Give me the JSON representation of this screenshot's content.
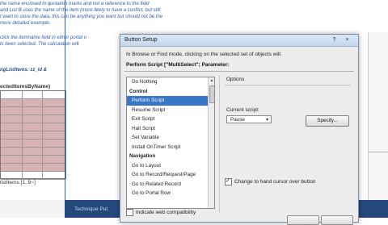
{
  "background": {
    "lines": [
      "the name enclosed in quotation marks and not a reference to the field",
      "and List B uses the name of the item (more likely to have a conflict, but still",
      "t want to store the data, this can be anything you want but should not be the",
      "more detailed example.",
      "",
      "click the itemname field in either portal o",
      "ts been selected. The calculation will",
      "",
      "ngListItems: zz_id &"
    ],
    "table_header": "ectedItemsByName)",
    "table_footer": "listItems [1..9~]",
    "status_text": "Technique Put"
  },
  "dialog": {
    "title": "Button Setup",
    "help_glyph": "?",
    "close_glyph": "×",
    "hint": "In Browse or Find mode, clicking on the selected set of objects will:",
    "perform_label": "Perform Script [\"MultiSelect\"; Parameter:",
    "steps": [
      {
        "label": "Do Nothing",
        "type": "item"
      },
      {
        "label": "Control",
        "type": "cat"
      },
      {
        "label": "Perform Script",
        "type": "item",
        "selected": true
      },
      {
        "label": "Resume Script",
        "type": "item"
      },
      {
        "label": "Exit Script",
        "type": "item"
      },
      {
        "label": "Halt Script",
        "type": "item"
      },
      {
        "label": "Set Variable",
        "type": "item"
      },
      {
        "label": "Install OnTimer Script",
        "type": "item"
      },
      {
        "label": "Navigation",
        "type": "cat"
      },
      {
        "label": "Go to Layout",
        "type": "item"
      },
      {
        "label": "Go to Record/Request/Page",
        "type": "item"
      },
      {
        "label": "Go to Related Record",
        "type": "item"
      },
      {
        "label": "Go to Portal Row",
        "type": "item"
      }
    ],
    "options_title": "Options",
    "current_script_label": "Current script:",
    "current_script_value": "Pause",
    "specify_label": "Specify...",
    "hand_cursor_label": "Change to hand cursor over button",
    "hand_cursor_checked": true,
    "web_compat_label": "Indicate web compatibility",
    "web_compat_checked": false
  },
  "colors": {
    "selection": "#3876c8",
    "statusbar": "#24487c",
    "pink_rows": "#d7b3b5"
  }
}
